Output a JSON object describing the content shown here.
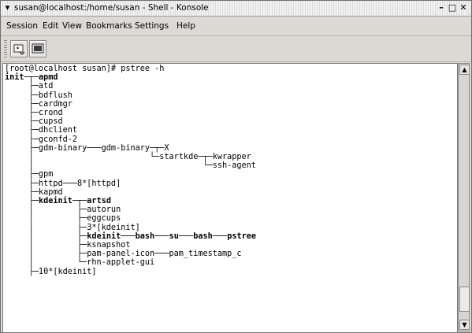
{
  "window": {
    "title": "susan@localhost:/home/susan - Shell - Konsole",
    "menu_icon": "chevron-down-icon",
    "buttons": [
      {
        "name": "minimize",
        "glyph": "–",
        "icon": "minimize-icon"
      },
      {
        "name": "maximize",
        "glyph": "□",
        "icon": "maximize-icon"
      },
      {
        "name": "close",
        "glyph": "✕",
        "icon": "close-icon"
      }
    ]
  },
  "menubar": {
    "items": [
      "Session",
      "Edit",
      "View",
      "Bookmarks",
      "Settings",
      "Help"
    ]
  },
  "toolbar": {
    "buttons": [
      {
        "icon": "new-session-icon"
      },
      {
        "icon": "terminal-window-icon"
      }
    ]
  },
  "terminal": {
    "lines": [
      "[root@localhost susan]# pstree -h",
      "init─┬─apmd",
      "     ├─atd",
      "     ├─bdflush",
      "     ├─cardmgr",
      "     ├─crond",
      "     ├─cupsd",
      "     ├─dhclient",
      "     ├─gconfd-2",
      "     ├─gdm-binary───gdm-binary─┬─X",
      "     │                        └─startkde─┬─kwrapper",
      "     │                                   └─ssh-agent",
      "     ├─gpm",
      "     ├─httpd───8*[httpd]",
      "     ├─kapmd",
      "     ├─kdeinit─┬─artsd",
      "     │         ├─autorun",
      "     │         ├─eggcups",
      "     │         ├─3*[kdeinit]",
      "     │         ├─kdeinit───bash───su───bash───pstree",
      "     │         ├─ksnapshot",
      "     │         ├─pam-panel-icon───pam_timestamp_c",
      "     │         └─rhn-applet-gui",
      "     ├─10*[kdeinit]"
    ],
    "bold_lines": [
      1,
      15,
      19
    ]
  },
  "scrollbar": {
    "up_icon": "scroll-up-arrow-icon",
    "down_icon": "scroll-down-arrow-icon",
    "position_fraction": 0.95
  }
}
